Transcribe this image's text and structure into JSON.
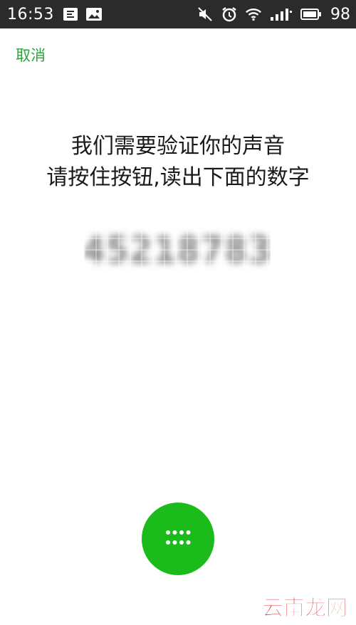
{
  "status_bar": {
    "time": "16:53",
    "battery": "98",
    "icons_left": [
      "edit-icon",
      "image-icon"
    ],
    "icons_right": [
      "mute-icon",
      "alarm-icon",
      "wifi-icon",
      "signal-icon",
      "battery-icon"
    ]
  },
  "header": {
    "cancel_label": "取消"
  },
  "instructions": {
    "line1": "我们需要验证你的声音",
    "line2": "请按住按钮,读出下面的数字"
  },
  "verification_code": "45218783",
  "record_button": {
    "icon": "keypad-dots-icon",
    "color": "#1bbb1b"
  },
  "watermark": "云南龙网",
  "colors": {
    "accent": "#2aa53a",
    "status_bar": "#2b2b2b"
  }
}
